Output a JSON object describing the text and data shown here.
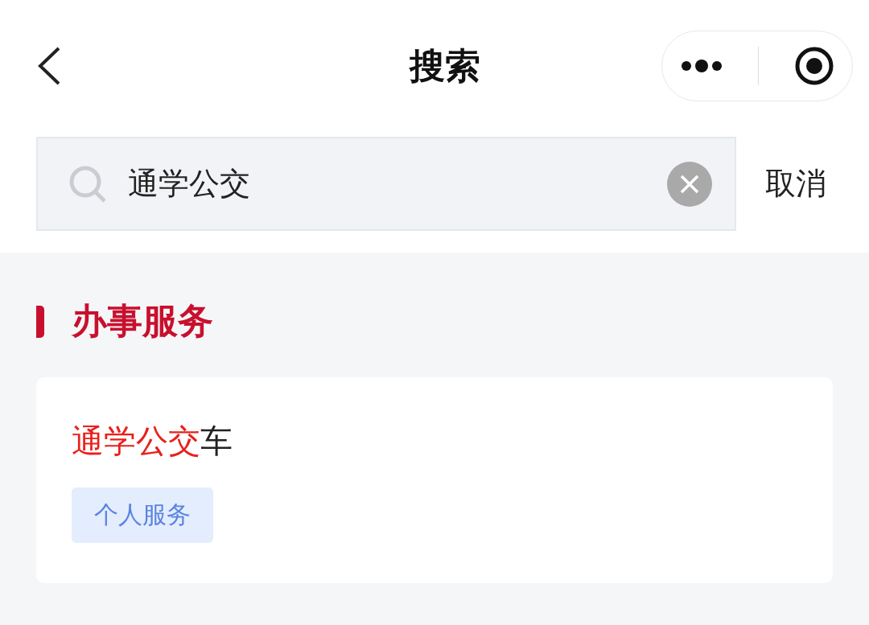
{
  "nav": {
    "title": "搜索"
  },
  "search": {
    "value": "通学公交",
    "cancel": "取消"
  },
  "section": {
    "title": "办事服务"
  },
  "results": [
    {
      "title": [
        {
          "text": "通学公交",
          "highlight": true
        },
        {
          "text": "车",
          "highlight": false
        }
      ],
      "tag": "个人服务"
    }
  ]
}
